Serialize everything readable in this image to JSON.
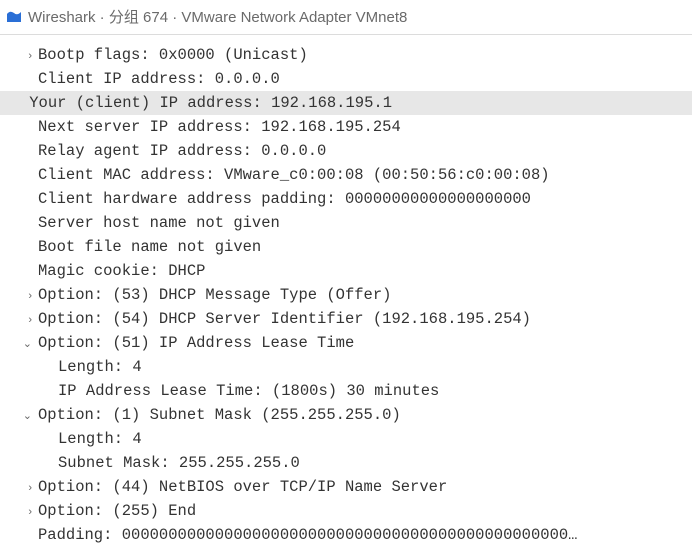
{
  "window": {
    "app_name": "Wireshark",
    "packet_label": "分组 674",
    "interface": "VMware Network Adapter VMnet8",
    "separator": " · "
  },
  "glyphs": {
    "closed": "›",
    "open": "⌄",
    "none": ""
  },
  "rows": [
    {
      "arrow": "closed",
      "indent": 0,
      "highlight": false,
      "text": "Bootp flags: 0x0000 (Unicast)"
    },
    {
      "arrow": "none",
      "indent": 0,
      "highlight": false,
      "text": "Client IP address: 0.0.0.0"
    },
    {
      "arrow": "none",
      "indent": 0,
      "highlight": true,
      "text": "Your (client) IP address: 192.168.195.1"
    },
    {
      "arrow": "none",
      "indent": 0,
      "highlight": false,
      "text": "Next server IP address: 192.168.195.254"
    },
    {
      "arrow": "none",
      "indent": 0,
      "highlight": false,
      "text": "Relay agent IP address: 0.0.0.0"
    },
    {
      "arrow": "none",
      "indent": 0,
      "highlight": false,
      "text": "Client MAC address: VMware_c0:00:08 (00:50:56:c0:00:08)"
    },
    {
      "arrow": "none",
      "indent": 0,
      "highlight": false,
      "text": "Client hardware address padding: 00000000000000000000"
    },
    {
      "arrow": "none",
      "indent": 0,
      "highlight": false,
      "text": "Server host name not given"
    },
    {
      "arrow": "none",
      "indent": 0,
      "highlight": false,
      "text": "Boot file name not given"
    },
    {
      "arrow": "none",
      "indent": 0,
      "highlight": false,
      "text": "Magic cookie: DHCP"
    },
    {
      "arrow": "closed",
      "indent": 0,
      "highlight": false,
      "text": "Option: (53) DHCP Message Type (Offer)"
    },
    {
      "arrow": "closed",
      "indent": 0,
      "highlight": false,
      "text": "Option: (54) DHCP Server Identifier (192.168.195.254)"
    },
    {
      "arrow": "open",
      "indent": 0,
      "highlight": false,
      "text": "Option: (51) IP Address Lease Time"
    },
    {
      "arrow": "none",
      "indent": 1,
      "highlight": false,
      "text": "Length: 4"
    },
    {
      "arrow": "none",
      "indent": 1,
      "highlight": false,
      "text": "IP Address Lease Time: (1800s) 30 minutes"
    },
    {
      "arrow": "open",
      "indent": 0,
      "highlight": false,
      "text": "Option: (1) Subnet Mask (255.255.255.0)"
    },
    {
      "arrow": "none",
      "indent": 1,
      "highlight": false,
      "text": "Length: 4"
    },
    {
      "arrow": "none",
      "indent": 1,
      "highlight": false,
      "text": "Subnet Mask: 255.255.255.0"
    },
    {
      "arrow": "closed",
      "indent": 0,
      "highlight": false,
      "text": "Option: (44) NetBIOS over TCP/IP Name Server"
    },
    {
      "arrow": "closed",
      "indent": 0,
      "highlight": false,
      "text": "Option: (255) End"
    },
    {
      "arrow": "none",
      "indent": 0,
      "highlight": false,
      "text": "Padding: 000000000000000000000000000000000000000000000000…"
    }
  ]
}
